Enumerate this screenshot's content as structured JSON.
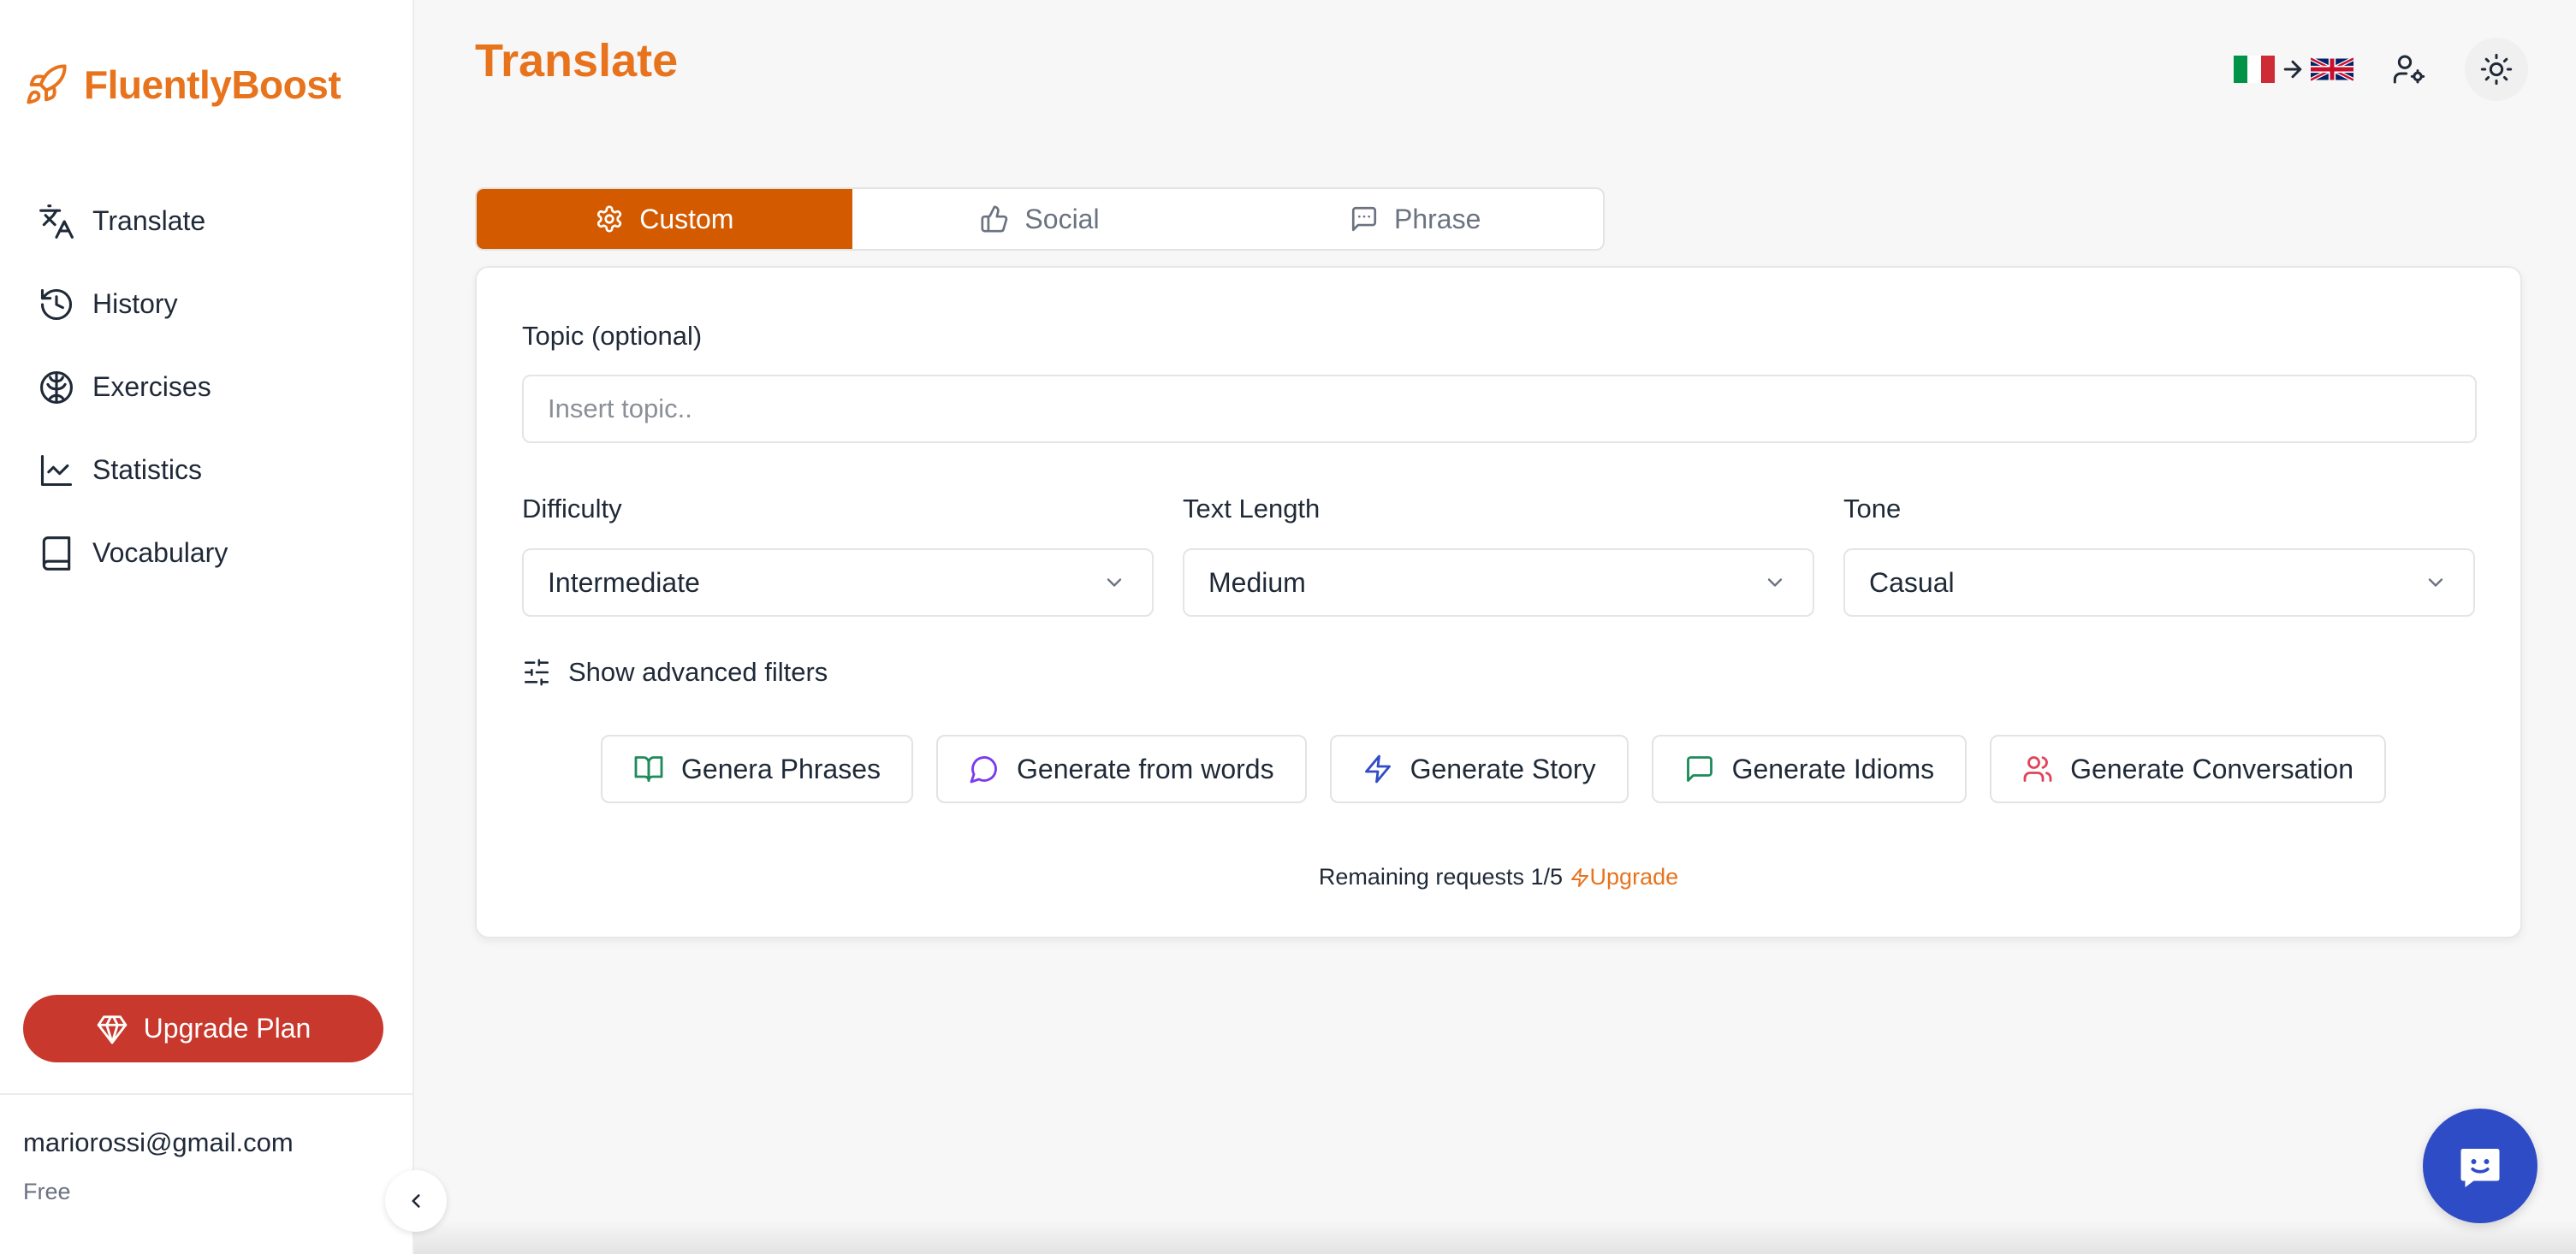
{
  "app": {
    "name": "FluentlyBoost"
  },
  "sidebar": {
    "items": [
      {
        "label": "Translate",
        "icon": "translate-icon"
      },
      {
        "label": "History",
        "icon": "history-icon"
      },
      {
        "label": "Exercises",
        "icon": "brain-icon"
      },
      {
        "label": "Statistics",
        "icon": "chart-icon"
      },
      {
        "label": "Vocabulary",
        "icon": "book-icon"
      }
    ],
    "upgrade_label": "Upgrade Plan",
    "user_email": "mariorossi@gmail.com",
    "user_plan": "Free"
  },
  "header": {
    "title": "Translate",
    "source_flag": "italy-flag",
    "target_flag": "uk-flag"
  },
  "tabs": [
    {
      "label": "Custom",
      "icon": "gear-icon",
      "active": true
    },
    {
      "label": "Social",
      "icon": "thumbs-up-icon",
      "active": false
    },
    {
      "label": "Phrase",
      "icon": "message-icon",
      "active": false
    }
  ],
  "form": {
    "topic_label": "Topic (optional)",
    "topic_placeholder": "Insert topic..",
    "topic_value": "",
    "difficulty_label": "Difficulty",
    "difficulty_value": "Intermediate",
    "length_label": "Text Length",
    "length_value": "Medium",
    "tone_label": "Tone",
    "tone_value": "Casual",
    "advanced_filters_label": "Show advanced filters"
  },
  "generate_buttons": [
    {
      "label": "Genera Phrases",
      "icon": "open-book-icon",
      "icon_color": "#1f8a5b"
    },
    {
      "label": "Generate from words",
      "icon": "chat-bubble-icon",
      "icon_color": "#7c3aed"
    },
    {
      "label": "Generate Story",
      "icon": "lightning-icon",
      "icon_color": "#2f4cc7"
    },
    {
      "label": "Generate Idioms",
      "icon": "message-square-icon",
      "icon_color": "#1f8a5b"
    },
    {
      "label": "Generate Conversation",
      "icon": "users-icon",
      "icon_color": "#e0445b"
    }
  ],
  "requests": {
    "text": "Remaining requests 1/5",
    "upgrade_label": "Upgrade"
  },
  "colors": {
    "brand": "#e8731d",
    "active_tab": "#d45a00",
    "upgrade_button": "#c9382c",
    "chat_fab": "#2f4cc7"
  }
}
